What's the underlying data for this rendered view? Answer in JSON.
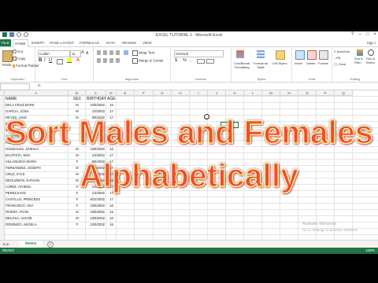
{
  "window": {
    "title": "EXCEL TUTORIAL 1 - Microsoft Excel",
    "sign_in": "Sign i"
  },
  "tabs": [
    "FILE",
    "HOME",
    "INSERT",
    "PAGE LAYOUT",
    "FORMULAS",
    "DATA",
    "REVIEW",
    "VIEW"
  ],
  "ribbon": {
    "clipboard": {
      "cut": "Cut",
      "copy": "Copy",
      "format_painter": "Format Painter",
      "paste": "Paste",
      "group": "Clipboard"
    },
    "font": {
      "name": "Calibri",
      "size": "11",
      "group": "Font"
    },
    "alignment": {
      "wrap_text": "Wrap Text",
      "merge_center": "Merge & Center",
      "group": "Alignment"
    },
    "number": {
      "format": "General",
      "currency": "$",
      "percent": "%",
      "comma": ",",
      "group": "Number"
    },
    "styles": {
      "conditional": "Conditional Formatting",
      "format_table": "Format as Table",
      "cell_styles": "Cell Styles",
      "group": "Styles"
    },
    "cells": {
      "insert": "Insert",
      "delete": "Delete",
      "format": "Format",
      "group": "Cells"
    },
    "editing": {
      "autosum": "AutoSum",
      "fill": "Fill",
      "clear": "Clear",
      "sort_filter": "Sort & Filter",
      "find_select": "Find & Select",
      "group": "Editing"
    }
  },
  "formula_bar": {
    "fx": "fx"
  },
  "columns": [
    "A",
    "B",
    "C",
    "D",
    "E",
    "F",
    "G",
    "H",
    "I",
    "J",
    "K",
    "L",
    "M",
    "N",
    "O",
    "P",
    "Q"
  ],
  "table": {
    "headers": [
      "NAME",
      "SEX",
      "BIRTHDAY",
      "AGE"
    ],
    "rows": [
      [
        "DELA CRUZ,MARK",
        "M",
        "10/5/2002",
        "16"
      ],
      [
        "GARCIA, JOSH",
        "M",
        "1/3/2002",
        "17"
      ],
      [
        "REYES, JAKE",
        "M",
        "9/6/2002",
        "17"
      ],
      [
        "RAMOS",
        "",
        "",
        ""
      ],
      [
        "MENDOZ",
        "",
        "",
        ""
      ],
      [
        "SANTOS",
        "",
        "",
        ""
      ],
      [
        "FLORES",
        "",
        "",
        ""
      ],
      [
        "GONZALES, JOSHUA",
        "M",
        "10/6/2002",
        "16"
      ],
      [
        "BAUTISTA, KEN",
        "M",
        "1/3/2002",
        "17"
      ],
      [
        "VILLANUEVA MARIA",
        "F",
        "9/6/2002",
        "17"
      ],
      [
        "FERNANDEZ, JOSEPH",
        "M",
        "8/4/2002",
        "17"
      ],
      [
        "CRUZ, KYLE",
        "M",
        "7/1/2002",
        "17"
      ],
      [
        "DEGUZMAN, NATHAN",
        "M",
        "10/4/2002",
        "16"
      ],
      [
        "LOPEZ, ATHENA",
        "F",
        "1/3/2002",
        "17"
      ],
      [
        "PEREZ,KAYE",
        "F",
        "1/3/2002",
        "17"
      ],
      [
        "CASTILLO, PRINCESS",
        "F",
        "8/22/2002",
        "17"
      ],
      [
        "FRANCISCO, ANA",
        "F",
        "10/5/2002",
        "16"
      ],
      [
        "RIVERA, RYAN",
        "M",
        "10/5/2002",
        "16"
      ],
      [
        "DELOSA, JACOB",
        "M",
        "10/5/2002",
        "16"
      ],
      [
        "DOMINGO, ANGELA",
        "F",
        "12/5/2002",
        "16"
      ]
    ]
  },
  "sheet_tab": "Sheet1",
  "status": {
    "ready": "READY",
    "zoom": "100%"
  },
  "watermark": {
    "line1": "Activate Windows",
    "line2": "Go to Settings to activate Windows."
  },
  "overlay": {
    "line1": "Sort Males and Females",
    "line2": "Alphabetically"
  },
  "colors": {
    "excel_green": "#217346",
    "overlay_text": "#f04c2d",
    "overlay_outline": "#ffe9a8"
  }
}
